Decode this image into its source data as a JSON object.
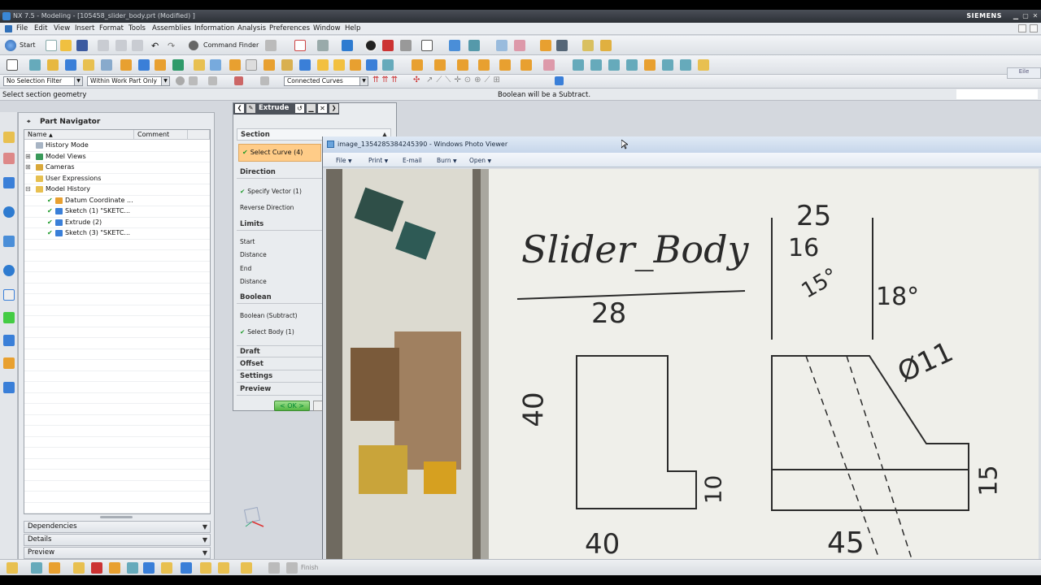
{
  "app": {
    "title": "NX 7.5 - Modeling - [105458_slider_body.prt (Modified) ]",
    "brand": "SIEMENS"
  },
  "menu": [
    "File",
    "Edit",
    "View",
    "Insert",
    "Format",
    "Tools",
    "Assemblies",
    "Information",
    "Analysis",
    "Preferences",
    "Window",
    "Help"
  ],
  "toolbar1": {
    "start_label": "Start",
    "command_finder_label": "Command Finder"
  },
  "selection_bar": {
    "filter": "No Selection Filter",
    "scope": "Within Work Part Only",
    "curve_rule": "Connected Curves"
  },
  "cue": {
    "prompt": "Select section geometry",
    "status": "Boolean will be a Subtract."
  },
  "navigator": {
    "title": "Part Navigator",
    "columns": [
      "Name",
      "Comment"
    ],
    "rows": [
      {
        "label": "History Mode",
        "indent": 1
      },
      {
        "label": "Model Views",
        "indent": 1
      },
      {
        "label": "Cameras",
        "indent": 1
      },
      {
        "label": "User Expressions",
        "indent": 1
      },
      {
        "label": "Model History",
        "indent": 1
      },
      {
        "label": "Datum Coordinate ...",
        "indent": 2
      },
      {
        "label": "Sketch (1) \"SKETC...",
        "indent": 2
      },
      {
        "label": "Extrude (2)",
        "indent": 2
      },
      {
        "label": "Sketch (3) \"SKETC...",
        "indent": 2
      }
    ],
    "panels": [
      "Dependencies",
      "Details",
      "Preview"
    ]
  },
  "extrude_dialog": {
    "title": "Extrude",
    "sections": {
      "section": "Section",
      "select_curve": "Select Curve (4)",
      "direction": "Direction",
      "specify_vector": "Specify Vector (1)",
      "reverse_direction": "Reverse Direction",
      "limits": "Limits",
      "start": "Start",
      "distance1": "Distance",
      "end": "End",
      "distance2": "Distance",
      "boolean": "Boolean",
      "boolean_value": "Boolean (Subtract)",
      "select_body": "Select Body (1)",
      "draft": "Draft",
      "offset": "Offset",
      "settings": "Settings",
      "preview": "Preview"
    },
    "ok_label": "< OK >"
  },
  "photo_viewer": {
    "title": "image_1354285384245390 - Windows Photo Viewer",
    "menu": [
      "File",
      "Print",
      "E-mail",
      "Burn",
      "Open"
    ],
    "drawing": {
      "title": "Slider_Body",
      "dims": [
        "28",
        "40",
        "40",
        "10",
        "25",
        "16",
        "15°",
        "18°",
        "Ø11",
        "15",
        "45"
      ]
    }
  },
  "bottom_bar": {
    "finish_label": "Finish"
  },
  "colors": {
    "accent": "#ffcc88",
    "check": "#1e9a2a"
  }
}
